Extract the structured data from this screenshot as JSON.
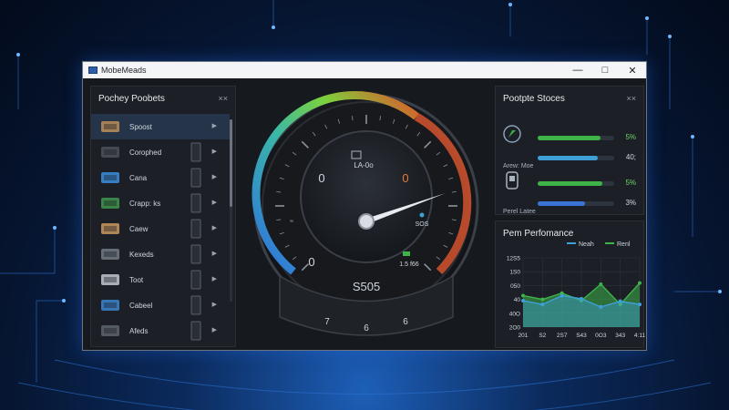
{
  "window": {
    "title": "MobeMeads",
    "min_icon": "minimize-icon",
    "max_icon": "maximize-icon",
    "close_icon": "close-icon"
  },
  "left_panel": {
    "title": "Pochey Poobets",
    "close_label": "××",
    "items": [
      {
        "label": "Spoost",
        "icon": "drill-icon"
      },
      {
        "label": "Corophed",
        "icon": "monitor-box-icon"
      },
      {
        "label": "Cana",
        "icon": "laptop-icon"
      },
      {
        "label": "Crapp: ks",
        "icon": "gpu-icon"
      },
      {
        "label": "Caew",
        "icon": "tool-icon"
      },
      {
        "label": "Kexeds",
        "icon": "keyboard-icon"
      },
      {
        "label": "Toot",
        "icon": "projector-icon"
      },
      {
        "label": "Cabeel",
        "icon": "cable-icon"
      },
      {
        "label": "Afeds",
        "icon": "case-icon"
      }
    ]
  },
  "gauge": {
    "top_label": "LA-0o",
    "left_label": "0",
    "right_label": "0",
    "inner_left": "0",
    "inner_right": "1.5 f66",
    "side_left": "’‘",
    "side_right": "SOS",
    "readout": "S505",
    "bottom_ticks": [
      "7",
      "6",
      "6"
    ],
    "needle_value": 0.82
  },
  "stocks_panel": {
    "title": "Pootpte Stoces",
    "close_label": "××",
    "rows": [
      {
        "label": "",
        "value": "5%",
        "fill": 0.82,
        "color": "#3db34a"
      },
      {
        "label": "Arew: Moe",
        "value": "40;",
        "fill": 0.78,
        "color": "#3fa0d8"
      },
      {
        "label": "",
        "value": "5%",
        "fill": 0.85,
        "color": "#3db34a"
      },
      {
        "label": "Perel Latee",
        "value": "3%",
        "fill": 0.62,
        "color": "#3a73d6"
      }
    ]
  },
  "perf_panel": {
    "title": "Pem Perfomance",
    "legend": [
      "Neah",
      "Renl"
    ],
    "legend_colors": [
      "#3fa0d8",
      "#3db34a"
    ]
  },
  "chart_data": {
    "type": "area",
    "categories": [
      "201",
      "S2",
      "2S7",
      "S43",
      "0O3",
      "343",
      "4:11"
    ],
    "series": [
      {
        "name": "Neah",
        "values": [
          620,
          560,
          700,
          650,
          520,
          610,
          560
        ]
      },
      {
        "name": "Renl",
        "values": [
          700,
          640,
          740,
          620,
          880,
          560,
          900
        ]
      }
    ],
    "yticks": [
      "12S5",
      "1S0",
      "050",
      "40",
      "40O",
      "2O0"
    ],
    "ylim": [
      200,
      1300
    ]
  }
}
